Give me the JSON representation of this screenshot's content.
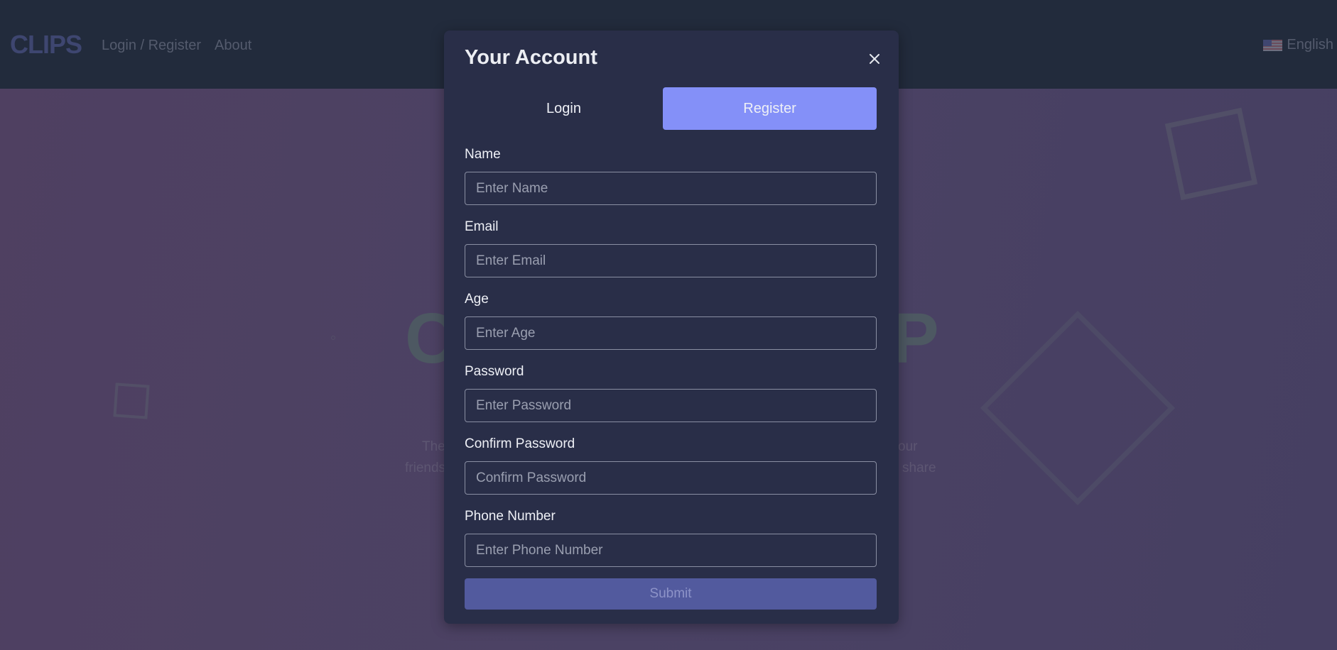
{
  "header": {
    "logo": "CLIPS",
    "nav": [
      {
        "label": "Login / Register"
      },
      {
        "label": "About"
      }
    ],
    "language": {
      "label": "English",
      "icon": "us-flag-icon"
    }
  },
  "background": {
    "hero_fragments": {
      "big_left": "C",
      "big_right": "P",
      "line1_left": "The",
      "line1_right": "our",
      "line2_left": "friends",
      "line2_right": "share"
    }
  },
  "modal": {
    "title": "Your Account",
    "close_icon": "close-icon",
    "tabs": [
      {
        "label": "Login",
        "active": false
      },
      {
        "label": "Register",
        "active": true
      }
    ],
    "fields": [
      {
        "label": "Name",
        "placeholder": "Enter Name",
        "value": ""
      },
      {
        "label": "Email",
        "placeholder": "Enter Email",
        "value": ""
      },
      {
        "label": "Age",
        "placeholder": "Enter Age",
        "value": ""
      },
      {
        "label": "Password",
        "placeholder": "Enter Password",
        "value": ""
      },
      {
        "label": "Confirm Password",
        "placeholder": "Confirm Password",
        "value": ""
      },
      {
        "label": "Phone Number",
        "placeholder": "Enter Phone Number",
        "value": ""
      }
    ],
    "submit_label": "Submit",
    "submit_disabled": true
  },
  "colors": {
    "accent": "#8490f8",
    "header_bg": "#222b3c",
    "modal_bg": "#292e48",
    "submit_bg": "#525a9e"
  }
}
